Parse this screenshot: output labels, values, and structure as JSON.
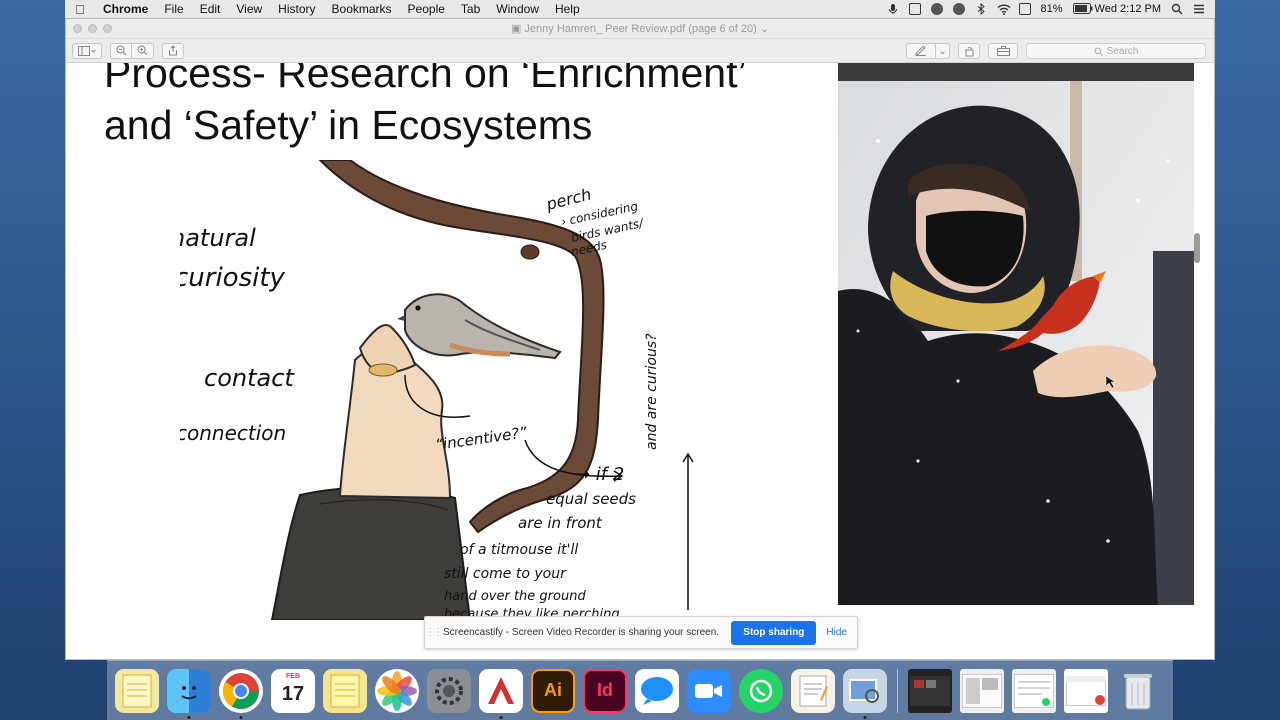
{
  "menubar": {
    "app": "Chrome",
    "items": [
      "File",
      "Edit",
      "View",
      "History",
      "Bookmarks",
      "People",
      "Tab",
      "Window",
      "Help"
    ],
    "battery": "81%",
    "clock": "Wed 2:12 PM"
  },
  "window": {
    "title": "Jenny Hamren_ Peer Review.pdf (page 6 of 20)",
    "search_placeholder": "Search"
  },
  "slide": {
    "title_line1": "Process- Research on ‘Enrichment’",
    "title_line2": "and ‘Safety’ in Ecosystems"
  },
  "sketch_notes": {
    "natural": "natural",
    "curiosity": "curiosity",
    "contact": "contact",
    "connection": "connection",
    "incentive": "“incentive?”",
    "perch": "perch",
    "perch_note1": "› considering",
    "perch_note2": "birds wants/",
    "perch_note3": "needs",
    "side_note": "and are curious?",
    "if_line1": "→ if 2",
    "if_line2": "equal seeds",
    "if_line3": "are in front",
    "if_line4": "of a titmouse it'll",
    "if_line5": "still come to your",
    "if_line6": "hand over the ground",
    "if_line7": "because they like perching"
  },
  "share_bar": {
    "message": "Screencastify - Screen Video Recorder is sharing your screen.",
    "stop_label": "Stop sharing",
    "hide_label": "Hide"
  },
  "dock": {
    "calendar_month": "FEB",
    "calendar_day": "17",
    "ai_label": "Ai",
    "id_label": "Id"
  },
  "colors": {
    "accent_blue": "#1a73e8",
    "cardinal_red": "#c8301e",
    "scarf_yellow": "#d9b85a"
  }
}
